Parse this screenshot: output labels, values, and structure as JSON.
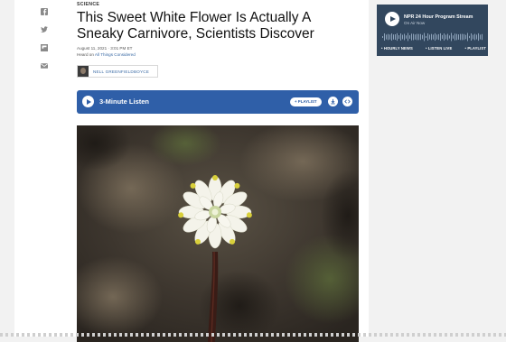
{
  "share": {
    "icons": [
      "facebook-icon",
      "twitter-icon",
      "flipboard-icon",
      "email-icon"
    ]
  },
  "article": {
    "slug": "SCIENCE",
    "headline": "This Sweet White Flower Is Actually A Sneaky Carnivore, Scientists Discover",
    "date": "August 11, 2021 · 3:01 PM ET",
    "heard_on_prefix": "Heard on ",
    "heard_on_link": "All Things Considered",
    "author": "NELL GREENFIELDBOYCE"
  },
  "audio": {
    "label": "3-Minute Listen",
    "playlist_label": "+ PLAYLIST",
    "accent": "#2f5fa8"
  },
  "sidebar_player": {
    "title": "NPR 24 Hour Program Stream",
    "subtitle": "On Air Now",
    "links": [
      "• HOURLY NEWS",
      "• LISTEN LIVE",
      "• PLAYLIST"
    ],
    "bg": "#32475e"
  }
}
